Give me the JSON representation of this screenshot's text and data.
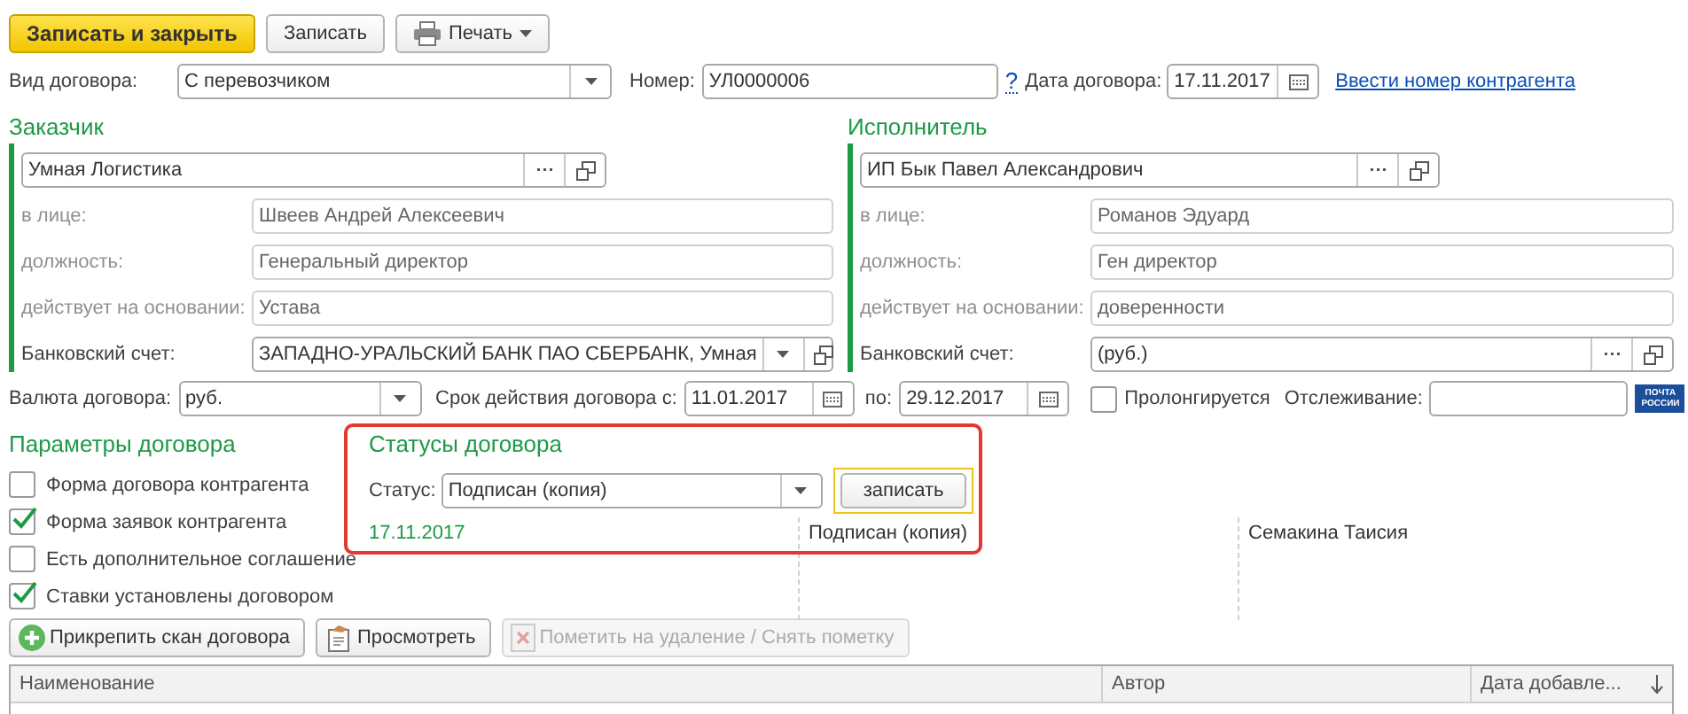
{
  "toolbar": {
    "buttons": [
      {
        "label": "Записать и закрыть",
        "kind": "primary"
      },
      {
        "label": "Записать",
        "kind": "plain"
      },
      {
        "label": "Печать",
        "kind": "menu"
      }
    ]
  },
  "header": {
    "contract_type": {
      "label": "Вид договора:",
      "value": "С перевозчиком"
    },
    "number": {
      "label": "Номер:",
      "value": "УЛ0000006"
    },
    "help": "?",
    "date": {
      "label": "Дата договора:",
      "value": "17.11.2017"
    },
    "link": "Ввести номер контрагента"
  },
  "parties": [
    {
      "title": "Заказчик",
      "name": "Умная Логистика",
      "fields": [
        {
          "label": "в лице:",
          "value": "Швеев Андрей Алексеевич"
        },
        {
          "label": "должность:",
          "value": "Генеральный директор"
        },
        {
          "label": "действует на основании:",
          "value": "Устава"
        }
      ],
      "bank": {
        "label": "Банковский счет:",
        "value": "ЗАПАДНО-УРАЛЬСКИЙ БАНК ПАО СБЕРБАНК, Умная",
        "kind": "dropdown"
      }
    },
    {
      "title": "Исполнитель",
      "name": "ИП Бык Павел Александрович",
      "fields": [
        {
          "label": "в лице:",
          "value": "Романов Эдуард"
        },
        {
          "label": "должность:",
          "value": "Ген директор"
        },
        {
          "label": "действует на основании:",
          "value": "доверенности"
        }
      ],
      "bank": {
        "label": "Банковский счет:",
        "value": "(руб.)",
        "kind": "choice"
      }
    }
  ],
  "terms": {
    "currency": {
      "label": "Валюта договора:",
      "value": "руб."
    },
    "period": {
      "label": "Срок действия договора с:",
      "from": "11.01.2017",
      "to_label": "по:",
      "to": "29.12.2017"
    },
    "prolong": {
      "label": "Пролонгируется",
      "checked": false
    },
    "tracking": {
      "label": "Отслеживание:"
    },
    "post_logo": [
      "ПОЧТА",
      "РОССИИ"
    ]
  },
  "parameters": {
    "title": "Параметры договора",
    "items": [
      {
        "label": "Форма договора контрагента",
        "checked": false
      },
      {
        "label": "Форма заявок контрагента",
        "checked": true
      },
      {
        "label": "Есть дополнительное соглашение",
        "checked": false
      },
      {
        "label": "Ставки установлены договором",
        "checked": true
      }
    ]
  },
  "statuses": {
    "title": "Статусы договора",
    "status_label": "Статус:",
    "status_value": "Подписан (копия)",
    "button": "записать",
    "highlighted": true,
    "history": [
      {
        "date": "17.11.2017",
        "status": "Подписан (копия)",
        "author": "Семакина Таисия"
      }
    ]
  },
  "attachments": {
    "buttons": [
      {
        "label": "Прикрепить скан договора",
        "kind": "attach",
        "disabled": false
      },
      {
        "label": "Просмотреть",
        "kind": "view",
        "disabled": false
      },
      {
        "label": "Пометить на удаление / Снять пометку",
        "kind": "delete",
        "disabled": true
      }
    ]
  },
  "table": {
    "columns": [
      {
        "label": "Наименование",
        "sorted": false
      },
      {
        "label": "Автор",
        "sorted": false
      },
      {
        "label": "Дата добавле...",
        "sorted": true
      }
    ]
  }
}
